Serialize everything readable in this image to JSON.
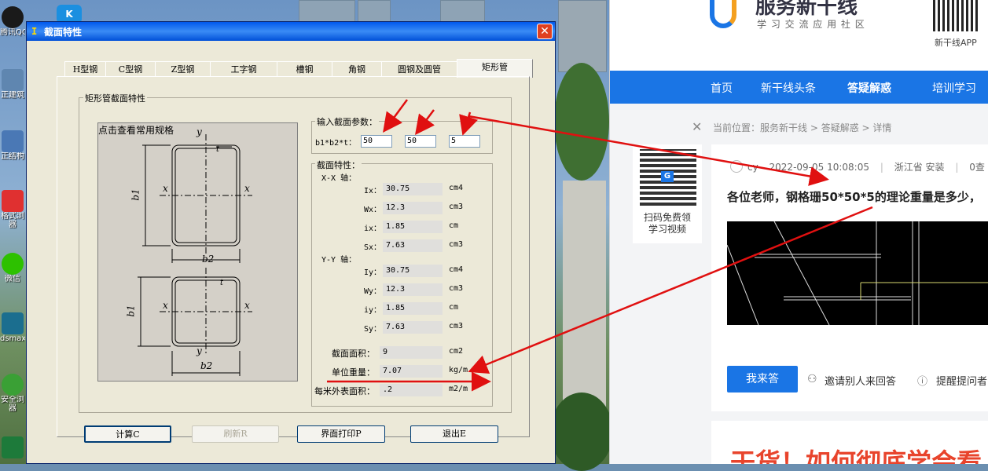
{
  "desktop": {
    "icons": [
      {
        "name": "qq",
        "label": "腾讯QQ",
        "color": "#1a1a1a"
      },
      {
        "name": "jianzhu",
        "label": "正建筑",
        "color": "#5f86b0"
      },
      {
        "name": "jiegou",
        "label": "正结构",
        "color": "#4a78b5"
      },
      {
        "name": "browser",
        "label": "格式浏\n器",
        "color": "#e03030"
      },
      {
        "name": "wechat",
        "label": "微信",
        "color": "#2dc100"
      },
      {
        "name": "3dsmax",
        "label": "dsmax",
        "color": "#1b6e8f"
      },
      {
        "name": "safe-browser",
        "label": "安全浏\n器",
        "color": "#3aa035"
      },
      {
        "name": "excel",
        "label": "",
        "color": "#1d7a3a"
      }
    ]
  },
  "dialog": {
    "title": "截面特性",
    "title_icon": "I",
    "close_label": "✕",
    "tabs": [
      "H型钢",
      "C型钢",
      "Z型钢",
      "工字钢",
      "槽钢",
      "角钢",
      "圆钢及圆管",
      "矩形管"
    ],
    "group_title": "矩形管截面特性",
    "image_caption": "点击查看常用规格",
    "input": {
      "title": "输入截面参数：",
      "label": "b1*b2*t：",
      "b1": "50",
      "b2": "50",
      "t": "5"
    },
    "props": {
      "title": "截面特性：",
      "xx_title": "X-X 轴：",
      "yy_title": "Y-Y 轴：",
      "xx": [
        {
          "label": "Ix：",
          "value": "30.75",
          "unit": "cm4"
        },
        {
          "label": "Wx：",
          "value": "12.3",
          "unit": "cm3"
        },
        {
          "label": "ix：",
          "value": "1.85",
          "unit": "cm"
        },
        {
          "label": "Sx：",
          "value": "7.63",
          "unit": "cm3"
        }
      ],
      "yy": [
        {
          "label": "Iy：",
          "value": "30.75",
          "unit": "cm4"
        },
        {
          "label": "Wy：",
          "value": "12.3",
          "unit": "cm3"
        },
        {
          "label": "iy：",
          "value": "1.85",
          "unit": "cm"
        },
        {
          "label": "Sy：",
          "value": "7.63",
          "unit": "cm3"
        }
      ],
      "area": {
        "label": "截面面积：",
        "value": "9",
        "unit": "cm2"
      },
      "weight": {
        "label": "单位重量：",
        "value": "7.07",
        "unit": "kg/m"
      },
      "surface": {
        "label": "每米外表面积：",
        "value": ".2",
        "unit": "m2/m"
      }
    },
    "diagram": {
      "y": "y",
      "x": "x",
      "t": "t",
      "b1": "b1",
      "b2": "b2"
    },
    "buttons": {
      "calc": "计算C",
      "refresh": "刷新R",
      "print": "界面打印P",
      "exit": "退出E"
    }
  },
  "website": {
    "brand_main": "服务新干线",
    "brand_sub": "学 习 交 流 应 用 社 区",
    "app_label": "新干线APP",
    "nav": [
      "首页",
      "新干线头条",
      "答疑解惑",
      "培训学习"
    ],
    "breadcrumb_prefix": "当前位置：",
    "breadcrumb": "服务新干线 > 答疑解惑 > 详情",
    "qr_text": "扫码免费领\n学习视频",
    "post": {
      "author": "cy",
      "datetime": "2022-09-05 10:08:05",
      "location": "浙江省",
      "category": "安装",
      "views_prefix": "0查",
      "title": "各位老师，钢格珊50*50*5的理论重量是多少，"
    },
    "answer_button": "我来答",
    "invite": "邀请别人来回答",
    "remind": "提醒提问者",
    "banner_text": "干货！如何彻底学会看"
  },
  "colors": {
    "accent": "#1a75e5",
    "arrow": "#e01010",
    "title_blue": "#0058ee"
  }
}
